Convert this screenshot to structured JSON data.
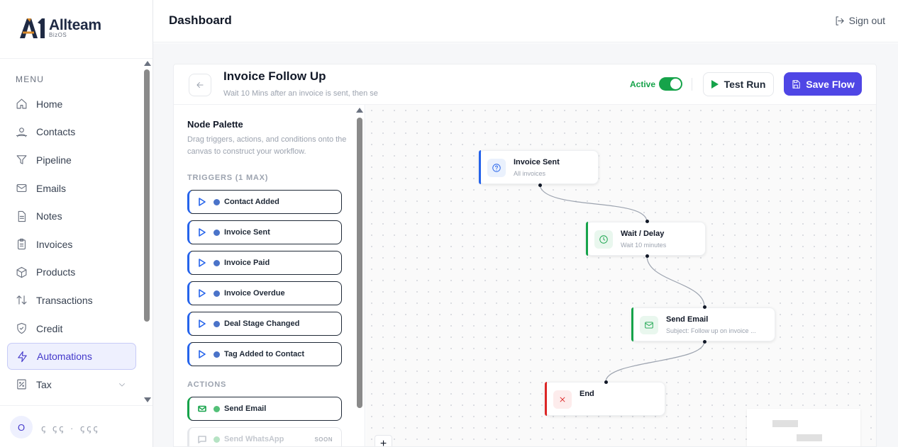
{
  "brand": {
    "name": "Allteam",
    "sub": "BizOS",
    "mark": "A1"
  },
  "sidebar": {
    "menu_caption": "MENU",
    "items": [
      {
        "label": "Home",
        "icon": "home-icon"
      },
      {
        "label": "Contacts",
        "icon": "contacts-icon"
      },
      {
        "label": "Pipeline",
        "icon": "filter-icon"
      },
      {
        "label": "Emails",
        "icon": "mail-icon"
      },
      {
        "label": "Notes",
        "icon": "note-icon"
      },
      {
        "label": "Invoices",
        "icon": "clipboard-icon"
      },
      {
        "label": "Products",
        "icon": "box-icon"
      },
      {
        "label": "Transactions",
        "icon": "arrows-icon"
      },
      {
        "label": "Credit",
        "icon": "shield-icon"
      },
      {
        "label": "Automations",
        "icon": "bolt-icon"
      },
      {
        "label": "Tax",
        "icon": "receipt-icon"
      }
    ],
    "active": "Automations",
    "user": {
      "initial": "O",
      "name": "ꞔ ꞔꞔ ·  ꞔꞔꞔ"
    }
  },
  "header": {
    "title": "Dashboard",
    "signout": "Sign out"
  },
  "flow": {
    "title": "Invoice Follow Up",
    "description": "Wait 10 Mins after an invoice is sent, then se",
    "active_label": "Active",
    "active": true,
    "test_run": "Test Run",
    "save": "Save Flow"
  },
  "palette": {
    "title": "Node Palette",
    "description": "Drag triggers, actions, and conditions onto the canvas to construct your workflow.",
    "triggers_heading": "TRIGGERS (1 MAX)",
    "triggers": [
      "Contact Added",
      "Invoice Sent",
      "Invoice Paid",
      "Invoice Overdue",
      "Deal Stage Changed",
      "Tag Added to Contact"
    ],
    "actions_heading": "ACTIONS",
    "actions": [
      {
        "label": "Send Email",
        "soon": ""
      },
      {
        "label": "Send WhatsApp",
        "soon": "SOON"
      }
    ]
  },
  "nodes": [
    {
      "title": "Invoice Sent",
      "subtitle": "All invoices",
      "icon": "question-icon",
      "color": "#2563eb"
    },
    {
      "title": "Wait / Delay",
      "subtitle": "Wait 10 minutes",
      "icon": "clock-icon",
      "color": "#16a34a"
    },
    {
      "title": "Send Email",
      "subtitle": "Subject: Follow up on invoice ...",
      "icon": "mail-icon",
      "color": "#16a34a"
    },
    {
      "title": "End",
      "subtitle": "",
      "icon": "close-icon",
      "color": "#dc2626"
    }
  ],
  "canvas": {
    "zoom_in": "+"
  },
  "colors": {
    "accent": "#4f46e5",
    "active": "#16a34a",
    "trigger": "#2563eb",
    "end": "#dc2626"
  }
}
